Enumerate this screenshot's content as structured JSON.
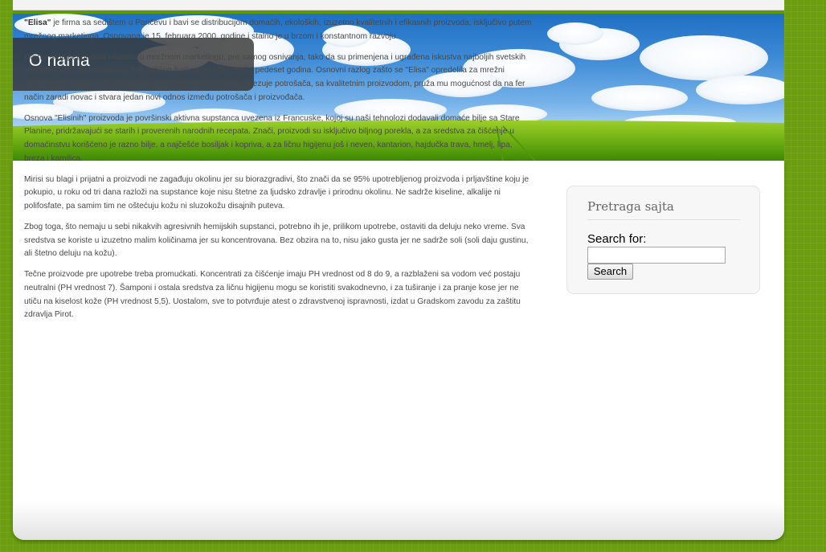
{
  "page": {
    "title": "O nama"
  },
  "article": {
    "p1_bold": "\"Elisa\"",
    "p1_rest": " je firma sa sedištem u Pančevu i bavi se distribucijom domaćih, ekoloških, izuzetno kvalitetnih i efikasnih proizvoda, isključivo putem mrežnog marketinga. Osnovana je 15. februara 2000. godine i stalno je u brzom i konstantnom razvoju.",
    "p2": "Iza nje stoji pet godina iskustva u mrežnom marketingu, pre samog osnivanja, tako da su primenjena i ugrađena iskustva najboljih svetskih sistema mrežnog marketinga koji odlično funkcionišu već preko pedeset godina. Osnovni razlog zašto se \"Elisa\" opredelila za mrežni marketing je taj što je to definitivno najsavršeniji sistem koji povezuje potrošača, sa kvalitetnim proizvodom, pruža mu mogućnost da na fer način zaradi novac i stvara jedan novi odnos između potrošača i proizvođača.",
    "p3": "Osnova \"Elisinih\" proizvoda je površinski aktivna supstanca uvezena iz Francuske, kojoj su naši tehnolozi dodavali domaće bilje sa Stare Planine, pridržavajući se starih i proverenih narodnih recepata. Znači, proizvodi su isključivo biljnog porekla, a za sredstva za čišćenje u domaćinstvu korišćeno je razno bilje, a najčešće bosiljak i kopriva, a za ličnu higijenu još i neven, kantarion, hajdučka trava, hmelj, lipa, breza i kamilica.",
    "p4": "Mirisi su blagi i prijatni a proizvodi ne zagađuju okolinu jer su biorazgradivi, što znači da se 95% upotrebljenog proizvoda i prljavštine koju je pokupio, u roku od tri dana razloži na supstance koje nisu štetne za ljudsko zdravlje i prirodnu okolinu. Ne sadrže kiseline, alkalije ni polifosfate, pa samim tim ne oštećuju kožu ni sluzokožu disajnih puteva.",
    "p5": "Zbog toga, što nemaju u sebi nikakvih agresivnih hemijskih supstanci, potrebno ih je, prilikom upotrebe, ostaviti da deluju neko vreme. Sva sredstva se koriste u izuzetno malim količinama jer su koncentrovana. Bez obzira na to, nisu jako gusta jer ne sadrže soli (soli daju gustinu, ali štetno deluju na kožu).",
    "p6": "Tečne proizvode pre upotrebe treba promućkati. Koncentrati za čišćenje imaju PH vrednost od 8 do 9, a razblaženi sa vodom već postaju neutralni (PH vrednost 7). Šamponi i ostala sredstva za ličnu higijenu mogu se koristiti svakodnevno, i za tuširanje i za pranje kose jer ne utiču na kiselost kože (PH vrednost 5,5). Uostalom, sve to potvrđuje atest o zdravstvenoj ispravnosti, izdat u Gradskom zavodu za zaštitu zdravlja Pirot."
  },
  "sidebar": {
    "widget_title": "Pretraga sajta",
    "search_label": "Search for:",
    "search_value": "",
    "search_button": "Search"
  },
  "colors": {
    "background": "#6a9e0e",
    "accent_strip": "#5c9a08",
    "title_box": "#343434"
  }
}
